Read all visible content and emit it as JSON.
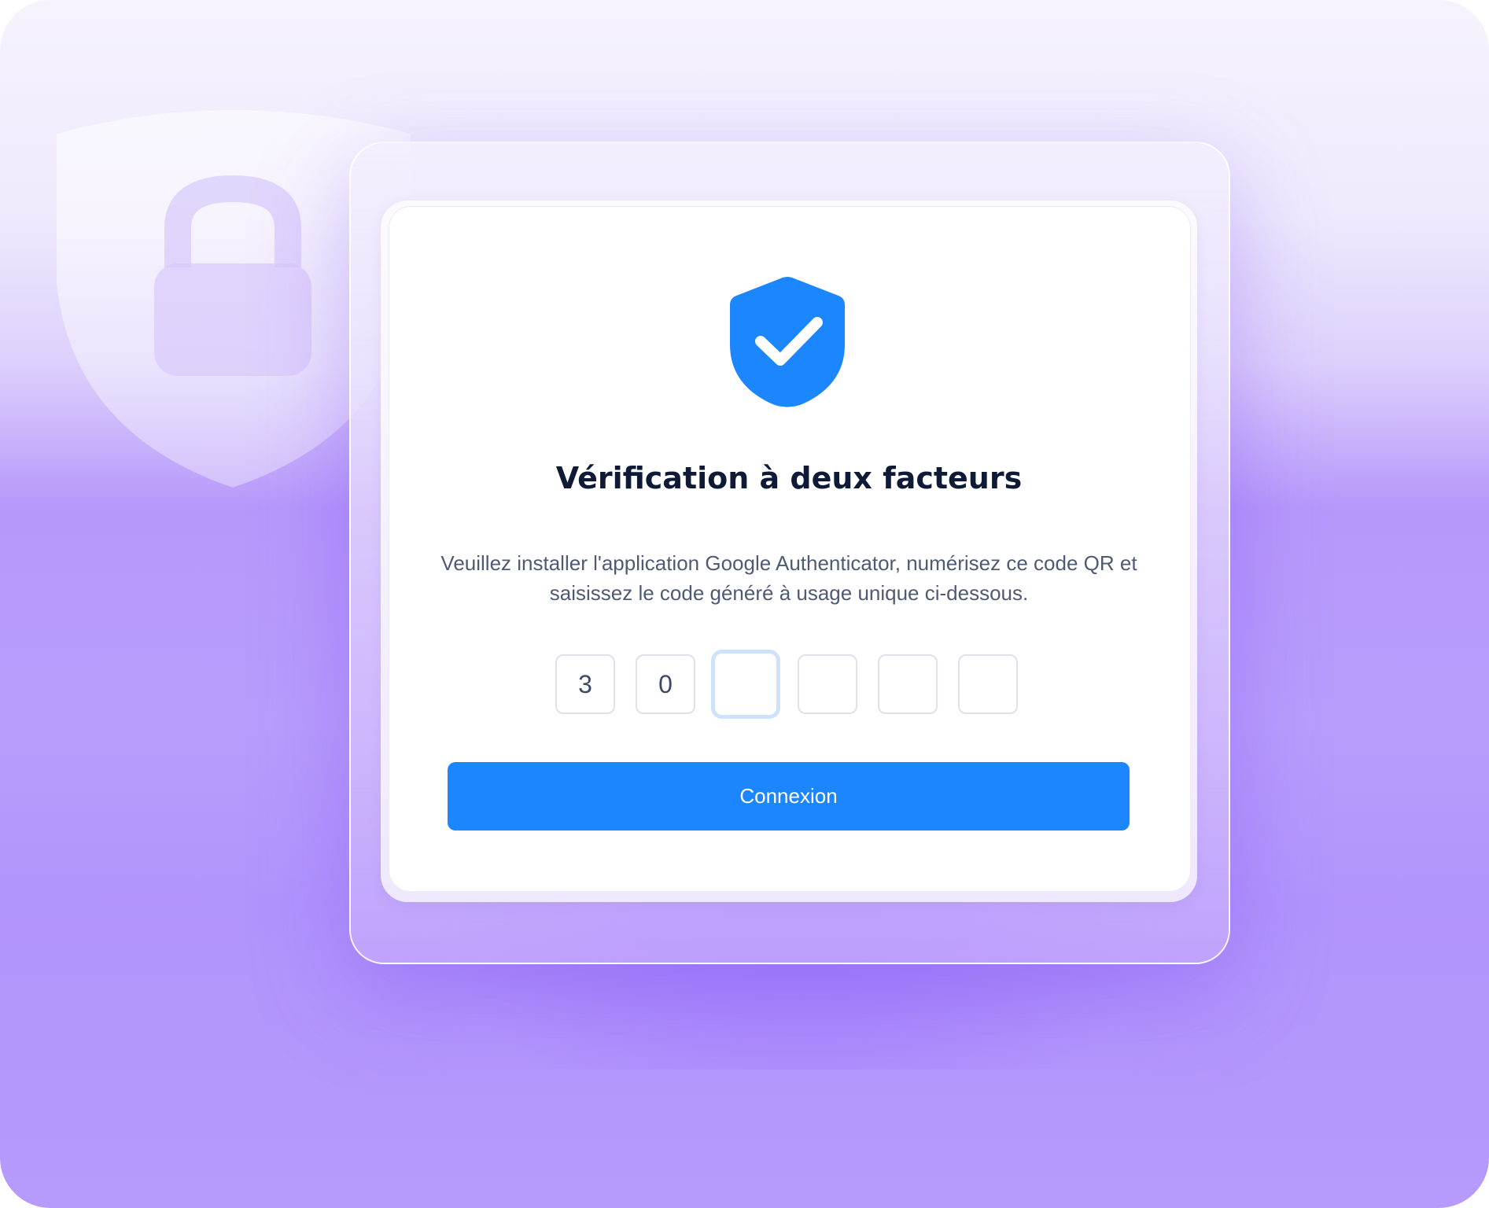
{
  "verification": {
    "title": "Vérification à deux facteurs",
    "description": "Veuillez installer l'application Google Authenticator, numérisez ce code QR et saisissez le code généré à usage unique ci-dessous.",
    "otp_digits": [
      "3",
      "0",
      "",
      "",
      "",
      ""
    ],
    "submit_label": "Connexion"
  },
  "icons": {
    "main": "shield-check-icon",
    "background": "shield-lock-icon"
  },
  "colors": {
    "accent": "#1b86fe",
    "title": "#0e1a36",
    "text": "#4f5a73",
    "background_purple": "#b69afc",
    "focus_ring": "#cfe2fb"
  }
}
